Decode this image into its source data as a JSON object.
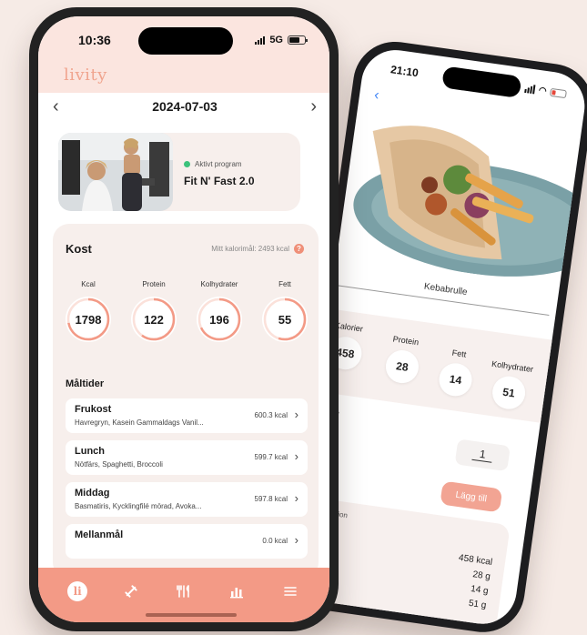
{
  "back": {
    "time": "21:10",
    "food_name": "Kebabrulle",
    "macros": [
      {
        "label": "Kalorier",
        "value": "458"
      },
      {
        "label": "Protein",
        "value": "28"
      },
      {
        "label": "Fett",
        "value": "14"
      },
      {
        "label": "Kolhydrater",
        "value": "51"
      }
    ],
    "portion_label": "ner",
    "quantity": "1",
    "add_button": "Lägg till",
    "nutrition_header": "de per portion",
    "nutrition_values": [
      "458 kcal",
      "28 g",
      "14 g",
      "51 g"
    ]
  },
  "front": {
    "time": "10:36",
    "network": "5G",
    "logo": "livity",
    "date": "2024-07-03",
    "program": {
      "status": "Aktivt program",
      "name": "Fit N' Fast 2.0"
    },
    "kost": {
      "title": "Kost",
      "goal": "Mitt kalorimål: 2493 kcal",
      "help_icon": "?",
      "rings": [
        {
          "label": "Kcal",
          "value": "1798",
          "progress": 0.72
        },
        {
          "label": "Protein",
          "value": "122",
          "progress": 0.6
        },
        {
          "label": "Kolhydrater",
          "value": "196",
          "progress": 0.68
        },
        {
          "label": "Fett",
          "value": "55",
          "progress": 0.55
        }
      ]
    },
    "meals_title": "Måltider",
    "meals": [
      {
        "name": "Frukost",
        "desc": "Havregryn, Kasein Gammaldags Vanil...",
        "kcal": "600.3 kcal"
      },
      {
        "name": "Lunch",
        "desc": "Nötfärs, Spaghetti, Broccoli",
        "kcal": "599.7 kcal"
      },
      {
        "name": "Middag",
        "desc": "Basmatiris, Kycklingfilé mörad, Avoka...",
        "kcal": "597.8 kcal"
      },
      {
        "name": "Mellanmål",
        "desc": "",
        "kcal": "0.0 kcal"
      }
    ],
    "tabs": [
      "home-tab",
      "workout-tab",
      "food-tab",
      "stats-tab",
      "menu-tab"
    ],
    "tab_home_glyph": "li"
  },
  "colors": {
    "accent": "#f39a86",
    "peach_bg": "#fbe5df",
    "card_bg": "#f7efec",
    "active_green": "#3cc27b"
  }
}
